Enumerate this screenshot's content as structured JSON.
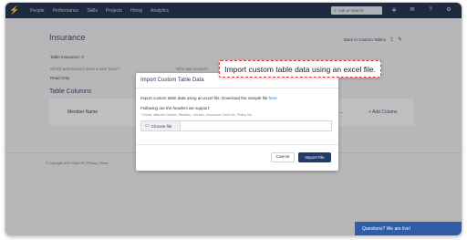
{
  "nav": {
    "items": [
      "People",
      "Performance",
      "Skills",
      "Projects",
      "Hiring",
      "Analytics"
    ],
    "search_placeholder": "Ask or search"
  },
  "page": {
    "title": "Insurance",
    "back_link": "Back to Custom Tables",
    "table_insurance": "Table Insurance: 0",
    "permissions_text": "Which permissions does a user have?",
    "permissions_text_2": "Who has access?",
    "access_level": "Read Only",
    "table_columns_title": "Table Columns",
    "column_member_name": "Member Name",
    "column_right": "...",
    "add_column": "+ Add Column",
    "footer": "© Copyright 2022 Keka HR  |  Privacy  |  Terms"
  },
  "modal": {
    "title": "Import Custom Table Data",
    "description": "Import custom table data using an excel file. Download the sample file",
    "sample_link": "here",
    "headers_note": "Following are the headers we support:",
    "fields": "* Email, Member Name, Relation, Gender, Insurance Card No, Policy No",
    "choose_file": "Choose file",
    "cancel": "Cancel",
    "import": "Import File"
  },
  "callout": {
    "text": "Import custom table data using an excel file."
  },
  "chat": {
    "text": "Questions? We are live!"
  }
}
